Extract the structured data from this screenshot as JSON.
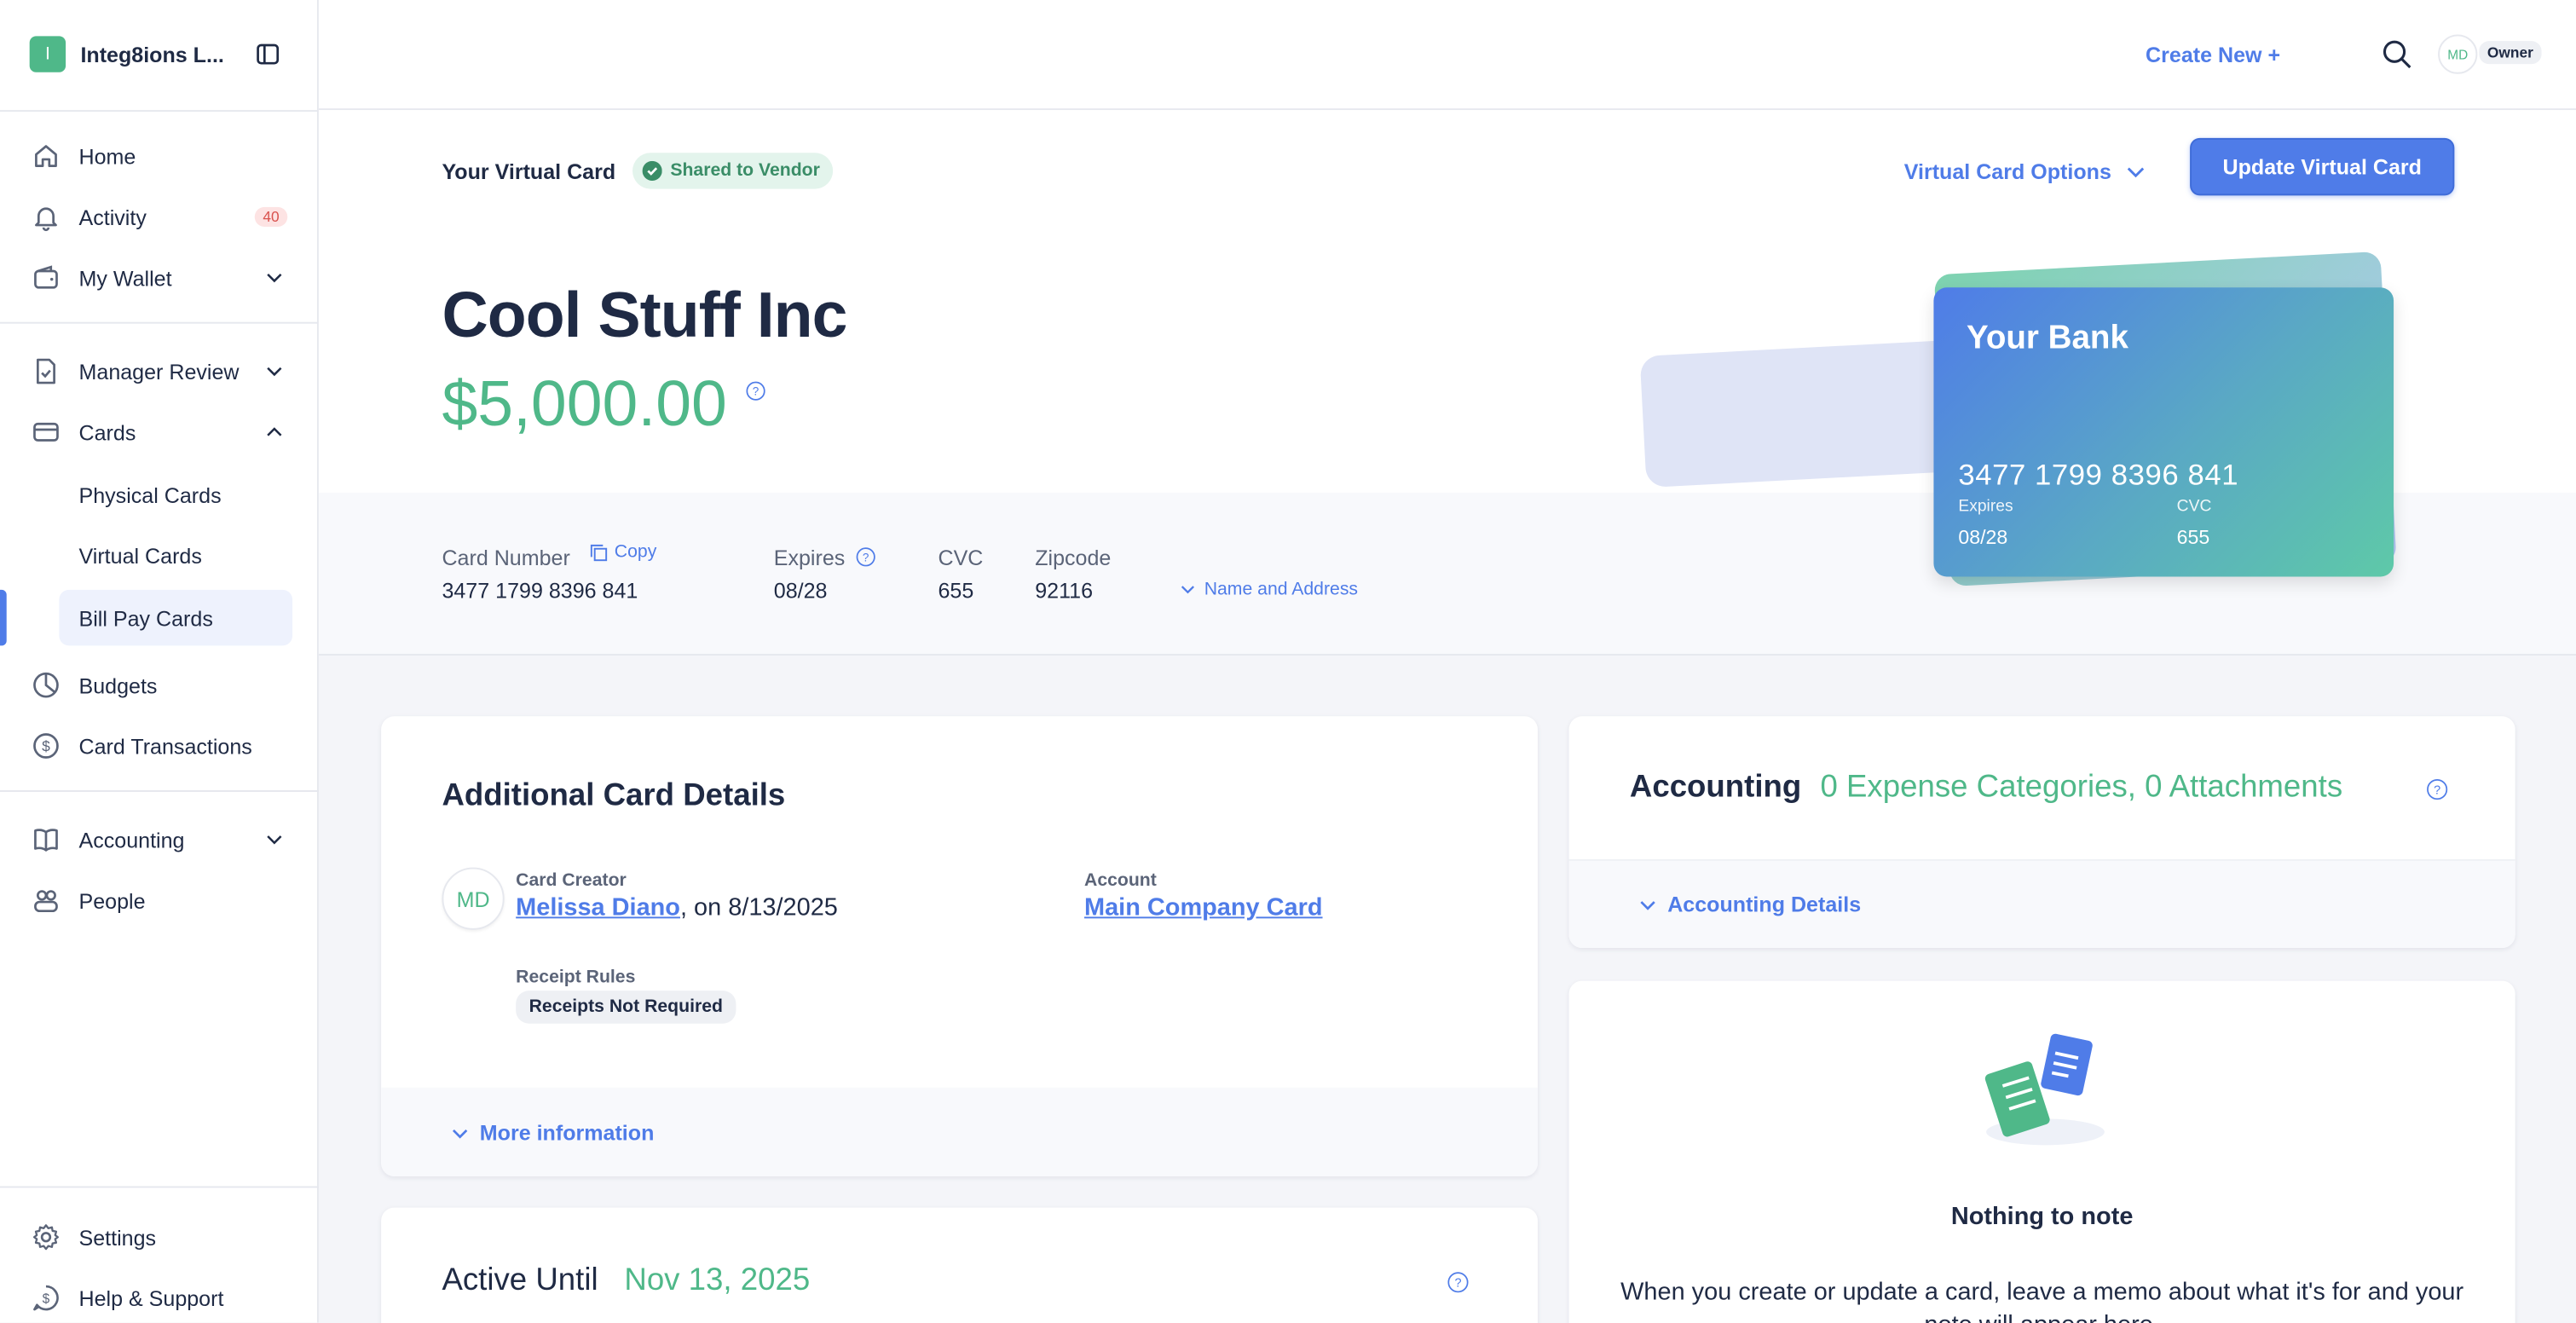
{
  "brand": {
    "initial": "I",
    "name": "Integ8ions L..."
  },
  "nav": {
    "home": "Home",
    "activity": "Activity",
    "activity_count": "40",
    "wallet": "My Wallet",
    "manager_review": "Manager Review",
    "cards": "Cards",
    "physical_cards": "Physical Cards",
    "virtual_cards": "Virtual Cards",
    "bill_pay_cards": "Bill Pay Cards",
    "budgets": "Budgets",
    "card_transactions": "Card Transactions",
    "accounting": "Accounting",
    "people": "People",
    "settings": "Settings",
    "help": "Help & Support"
  },
  "topbar": {
    "create_new": "Create New +",
    "user_initials": "MD",
    "role": "Owner"
  },
  "card_header": {
    "label": "Your Virtual Card",
    "status": "Shared to Vendor",
    "options": "Virtual Card Options",
    "update_button": "Update Virtual Card",
    "merchant": "Cool Stuff Inc",
    "amount": "$5,000.00"
  },
  "card_visual": {
    "bank": "Your Bank",
    "number": "3477 1799 8396 841",
    "expires_label": "Expires",
    "expires": "08/28",
    "cvc_label": "CVC",
    "cvc": "655"
  },
  "card_details": {
    "number_label": "Card Number",
    "copy": "Copy",
    "number": "3477 1799 8396 841",
    "expires_label": "Expires",
    "expires": "08/28",
    "cvc_label": "CVC",
    "cvc": "655",
    "zip_label": "Zipcode",
    "zip": "92116",
    "name_address": "Name and Address"
  },
  "additional": {
    "title": "Additional Card Details",
    "creator_initials": "MD",
    "creator_label": "Card Creator",
    "creator_name": "Melissa Diano",
    "creator_date": ", on 8/13/2025",
    "account_label": "Account",
    "account": "Main Company Card",
    "receipt_label": "Receipt Rules",
    "receipt_value": "Receipts Not Required",
    "more": "More information"
  },
  "accounting": {
    "title": "Accounting",
    "summary": "0 Expense Categories, 0 Attachments",
    "details": "Accounting Details"
  },
  "notes": {
    "title": "Nothing to note",
    "body": "When you create or update a card, leave a memo about what it's for and your note will appear here."
  },
  "active_until": {
    "label": "Active Until",
    "date": "Nov 13, 2025"
  },
  "colors": {
    "accent": "#4f7ce8",
    "green": "#4fb889",
    "text": "#1f2a44"
  }
}
